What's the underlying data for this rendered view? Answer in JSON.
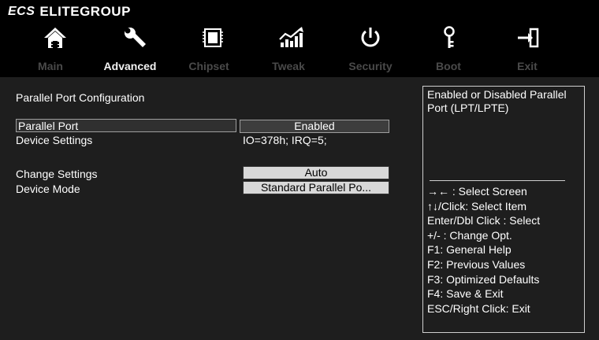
{
  "brand": {
    "logo": "ECS",
    "name": "ELITEGROUP"
  },
  "nav": {
    "icons": [
      "home-icon",
      "wrench-icon",
      "chip-icon",
      "performance-chart-icon",
      "power-icon",
      "key-icon",
      "exit-icon"
    ],
    "tabs": [
      {
        "label": "Main",
        "active": false
      },
      {
        "label": "Advanced",
        "active": true
      },
      {
        "label": "Chipset",
        "active": false
      },
      {
        "label": "Tweak",
        "active": false
      },
      {
        "label": "Security",
        "active": false
      },
      {
        "label": "Boot",
        "active": false
      },
      {
        "label": "Exit",
        "active": false
      }
    ]
  },
  "main": {
    "section_title": "Parallel Port Configuration",
    "parallel_port": {
      "label": "Parallel Port",
      "value": "Enabled"
    },
    "device_settings": {
      "label": "Device Settings",
      "value": "IO=378h; IRQ=5;"
    },
    "change_settings": {
      "label": "Change Settings",
      "value": "Auto"
    },
    "device_mode": {
      "label": "Device Mode",
      "value": "Standard Parallel Po..."
    }
  },
  "help": {
    "description": "Enabled or Disabled Parallel Port (LPT/LPTE)",
    "keys": [
      "→← : Select Screen",
      "↑↓/Click: Select Item",
      "Enter/Dbl Click : Select",
      "+/- : Change Opt.",
      "F1: General Help",
      "F2: Previous Values",
      "F3: Optimized Defaults",
      "F4: Save & Exit",
      "ESC/Right Click: Exit"
    ]
  },
  "colors": {
    "background": "#1e1e1e",
    "header": "#000000",
    "text": "#ffffff",
    "inactive_tab": "#4a4a4a",
    "highlight": "#303030"
  }
}
